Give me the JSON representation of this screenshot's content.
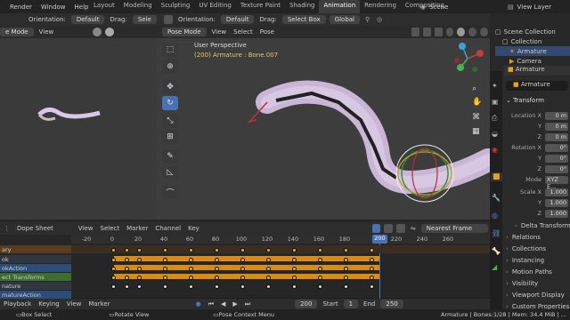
{
  "topbar": {
    "menus": [
      "Render",
      "Window",
      "Help"
    ],
    "workspaces": [
      "Layout",
      "Modeling",
      "Sculpting",
      "UV Editing",
      "Texture Paint",
      "Shading",
      "Animation",
      "Rendering",
      "Compositing",
      "Scene",
      "View Layer"
    ],
    "active_workspace": "Animation"
  },
  "left_viewport": {
    "header": {
      "orientation_label": "Orientation:",
      "orientation_value": "Default",
      "drag_label": "Drag:",
      "drag_value": "Sele"
    },
    "mode": "e Mode",
    "view_menu": "View"
  },
  "main_viewport": {
    "header": {
      "orientation_label": "Orientation:",
      "orientation_value": "Default",
      "drag_label": "Drag:",
      "drag_value": "Select Box",
      "transform": "Global"
    },
    "mode": "Pose Mode",
    "menus": [
      "View",
      "Select",
      "Pose"
    ],
    "overlay_title": "User Perspective",
    "overlay_sub": "(200) Armature : Bone.007"
  },
  "dope_sheet": {
    "editor": "Dope Sheet",
    "menus": [
      "View",
      "Select",
      "Marker",
      "Channel",
      "Key"
    ],
    "interpolation": "Nearest Frame",
    "ruler": [
      "-20",
      "0",
      "20",
      "40",
      "60",
      "80",
      "100",
      "120",
      "140",
      "160",
      "180",
      "200",
      "220",
      "240",
      "260"
    ],
    "current_frame": "200",
    "channels": [
      "ary",
      "ok",
      "okAction",
      "ect Transforms",
      "nature",
      "matureAction"
    ],
    "footer": {
      "playback": "Playback",
      "keying": "Keying",
      "view": "View",
      "marker": "Marker",
      "frame": "200",
      "start_label": "Start",
      "start_value": "1",
      "end_label": "End",
      "end_value": "250"
    }
  },
  "outliner": {
    "title": "Scene Collection",
    "items": [
      "Collection",
      "Armature",
      "Camera"
    ]
  },
  "properties": {
    "object": "Armature",
    "data_name": "Armature",
    "section": "Transform",
    "location": {
      "label": "Location X",
      "x": "0 m",
      "y": "0 m",
      "z": "0 m"
    },
    "rotation": {
      "label": "Rotation X",
      "x": "0°",
      "y": "0°",
      "z": "0°"
    },
    "mode_label": "Mode",
    "mode_value": "XYZ E...",
    "scale": {
      "label": "Scale X",
      "x": "1.000",
      "y": "1.000",
      "z": "1.000"
    },
    "sections": [
      "Delta Transform",
      "Relations",
      "Collections",
      "Instancing",
      "Motion Paths",
      "Visibility",
      "Viewport Display",
      "Custom Properties"
    ]
  },
  "status_bar": {
    "items": [
      "Box Select",
      "Rotate View",
      "Pose Context Menu"
    ],
    "right": "Armature | Bones:1/28 | Mem: 34.4 MiB | ..."
  },
  "colors": {
    "accent": "#4772b3",
    "keyframe": "#e8b828",
    "channel_bar": "#d88a1a",
    "active_tab": "#3d3d3d"
  }
}
